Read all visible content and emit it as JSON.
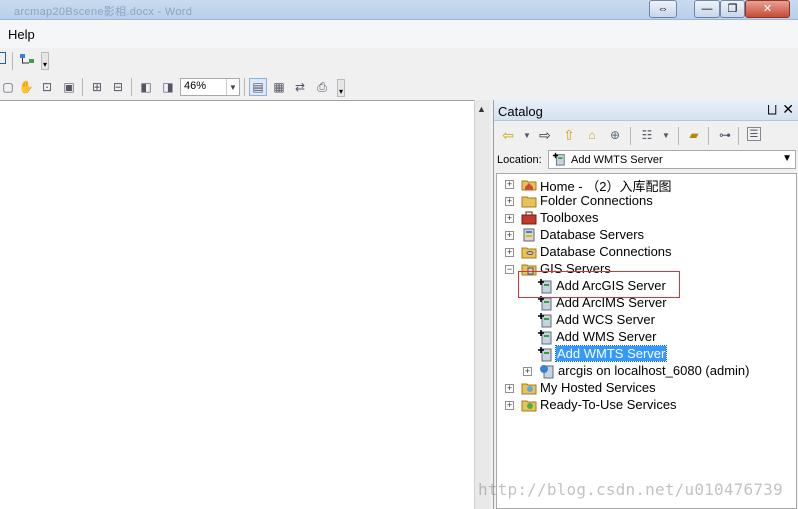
{
  "window": {
    "title": "arcmap20Bscene影相.docx - Word",
    "controls": {
      "restore_glyph": "⇔",
      "minimize_glyph": "—",
      "maximize_glyph": "❐",
      "close_glyph": "✕"
    }
  },
  "menubar": {
    "help": "Help"
  },
  "toolbar": {
    "zoom_value": "46%"
  },
  "catalog": {
    "title": "Catalog",
    "pin_glyph": "⨆",
    "close_glyph": "✕",
    "location_label": "Location:",
    "location_value": "Add WMTS Server",
    "tree": [
      {
        "label": "Home - （2）入库配图",
        "icon": "home-folder-icon",
        "expander": "+"
      },
      {
        "label": "Folder Connections",
        "icon": "folder-connections-icon",
        "expander": "+"
      },
      {
        "label": "Toolboxes",
        "icon": "toolbox-icon",
        "expander": "+"
      },
      {
        "label": "Database Servers",
        "icon": "database-servers-icon",
        "expander": "+"
      },
      {
        "label": "Database Connections",
        "icon": "database-connections-icon",
        "expander": "+"
      },
      {
        "label": "GIS Servers",
        "icon": "gis-servers-icon",
        "expander": "−"
      },
      {
        "label": "Add ArcGIS Server",
        "icon": "add-server-icon"
      },
      {
        "label": "Add ArcIMS Server",
        "icon": "add-server-icon"
      },
      {
        "label": "Add WCS Server",
        "icon": "add-server-icon"
      },
      {
        "label": "Add WMS Server",
        "icon": "add-server-icon"
      },
      {
        "label": "Add WMTS Server",
        "icon": "add-server-icon",
        "selected": true
      },
      {
        "label": "arcgis on localhost_6080 (admin)",
        "icon": "server-connection-icon",
        "expander": "+"
      },
      {
        "label": "My Hosted Services",
        "icon": "hosted-services-icon",
        "expander": "+"
      },
      {
        "label": "Ready-To-Use Services",
        "icon": "ready-services-icon",
        "expander": "+"
      }
    ]
  },
  "watermark": "http://blog.csdn.net/u010476739",
  "colors": {
    "selection": "#3399ff",
    "highlight_box": "#d9343a",
    "titlebar": "#c9dbf0"
  }
}
